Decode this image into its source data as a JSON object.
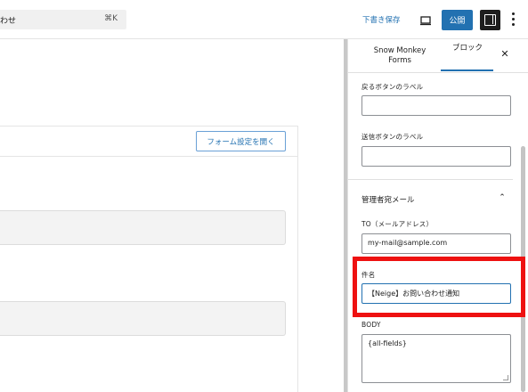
{
  "toolbar": {
    "command_text": "わせ",
    "command_shortcut": "⌘K",
    "save_draft": "下書き保存",
    "publish": "公開"
  },
  "canvas": {
    "open_form_settings": "フォーム設定を開く"
  },
  "sidebar": {
    "tab_snow_monkey": "Snow Monkey Forms",
    "tab_block": "ブロック",
    "back_button_label": "戻るボタンのラベル",
    "back_button_value": "",
    "submit_button_label": "送信ボタンのラベル",
    "submit_button_value": "",
    "admin_mail_section": "管理者宛メール",
    "to_label": "TO（メールアドレス）",
    "to_value": "my-mail@sample.com",
    "subject_label": "件名",
    "subject_value": "【Neige】お問い合わせ通知",
    "body_label": "BODY",
    "body_value": "{all-fields}"
  },
  "colors": {
    "accent": "#2271b1",
    "highlight": "#ee1111"
  }
}
